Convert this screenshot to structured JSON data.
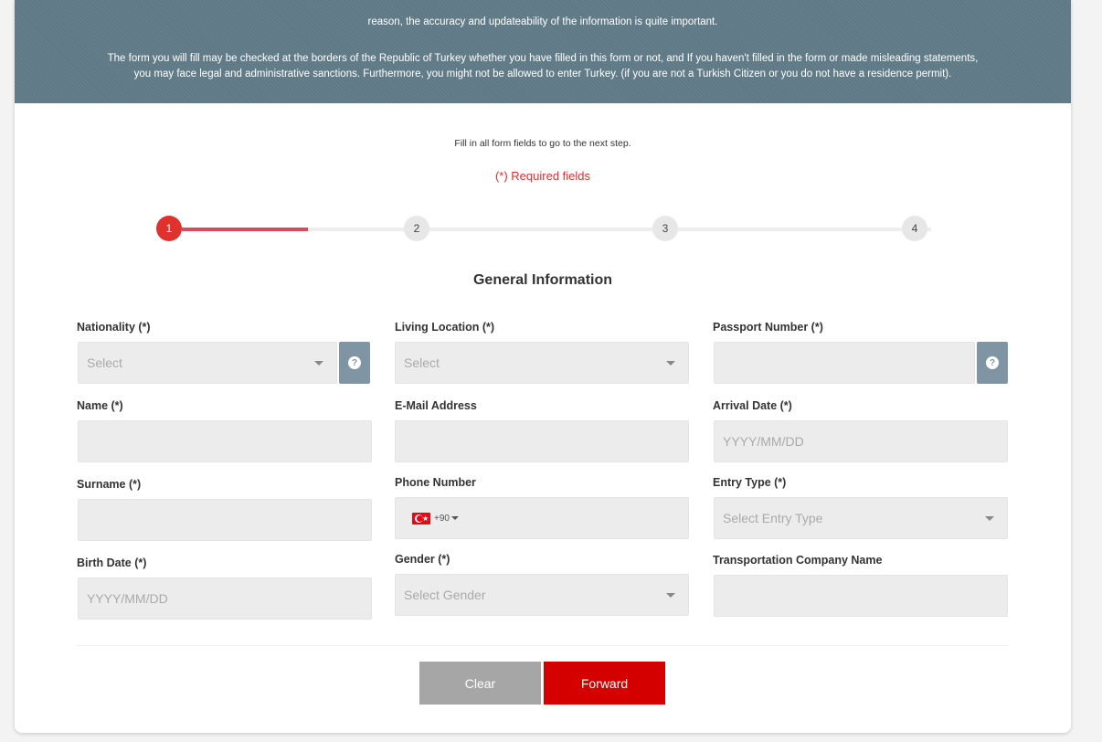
{
  "banner": {
    "line1": "reason, the accuracy and updateability of the information is quite important.",
    "line2": "The form you will fill may be checked at the borders of the Republic of Turkey whether you have filled in this form or not, and If you haven't filled in the form or made misleading statements,",
    "line3": "you may face legal and administrative sanctions. Furthermore, you might not be allowed to enter Turkey. (if you are not a Turkish Citizen or you do not have a residence permit)."
  },
  "hint": "Fill in all form fields to go to the next step.",
  "required_note": "(*) Required fields",
  "stepper": {
    "steps": [
      "1",
      "2",
      "3",
      "4"
    ],
    "active_step": 1
  },
  "section_title": "General Information",
  "fields": {
    "nationality": {
      "label": "Nationality (*)",
      "placeholder": "Select"
    },
    "living_location": {
      "label": "Living Location (*)",
      "placeholder": "Select"
    },
    "passport_number": {
      "label": "Passport Number (*)",
      "value": ""
    },
    "name": {
      "label": "Name (*)",
      "value": ""
    },
    "email": {
      "label": "E-Mail Address",
      "value": ""
    },
    "arrival_date": {
      "label": "Arrival Date (*)",
      "placeholder": "YYYY/MM/DD"
    },
    "surname": {
      "label": "Surname (*)",
      "value": ""
    },
    "phone": {
      "label": "Phone Number",
      "country_code": "+90"
    },
    "entry_type": {
      "label": "Entry Type (*)",
      "placeholder": "Select Entry Type"
    },
    "birth_date": {
      "label": "Birth Date (*)",
      "placeholder": "YYYY/MM/DD"
    },
    "gender": {
      "label": "Gender (*)",
      "placeholder": "Select Gender"
    },
    "transport_company": {
      "label": "Transportation Company Name",
      "value": ""
    }
  },
  "help_icon_glyph": "?",
  "buttons": {
    "clear": "Clear",
    "forward": "Forward"
  },
  "colors": {
    "banner": "#5f7a86",
    "accent_red": "#d40000",
    "step_active": "#e0322d",
    "required_text": "#d8312b"
  }
}
